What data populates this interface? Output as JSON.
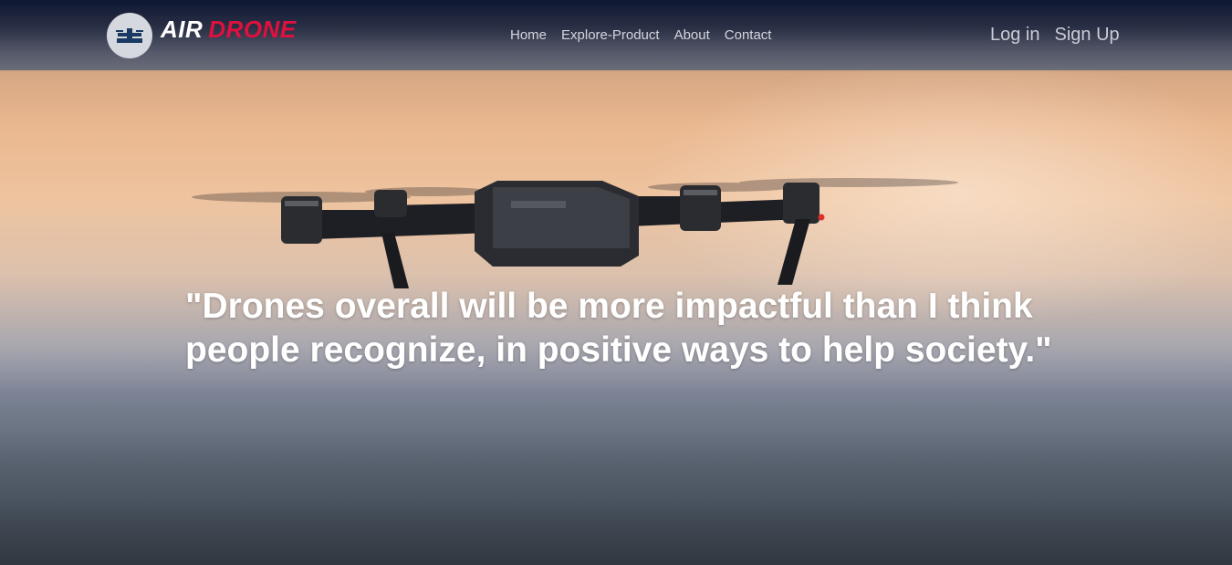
{
  "brand": {
    "part1": "AIR",
    "part2": "DRONE",
    "accent_color": "#e0103e",
    "logo_icon": "drone-logo-icon"
  },
  "nav": {
    "items": [
      {
        "label": "Home"
      },
      {
        "label": "Explore-Product"
      },
      {
        "label": "About"
      },
      {
        "label": "Contact"
      }
    ]
  },
  "auth": {
    "login_label": "Log in",
    "signup_label": "Sign Up"
  },
  "hero": {
    "quote_line1": "\"Drones overall will be more impactful than I think",
    "quote_line2": "people recognize, in positive ways to help society.\"",
    "image": "drone-photo"
  }
}
